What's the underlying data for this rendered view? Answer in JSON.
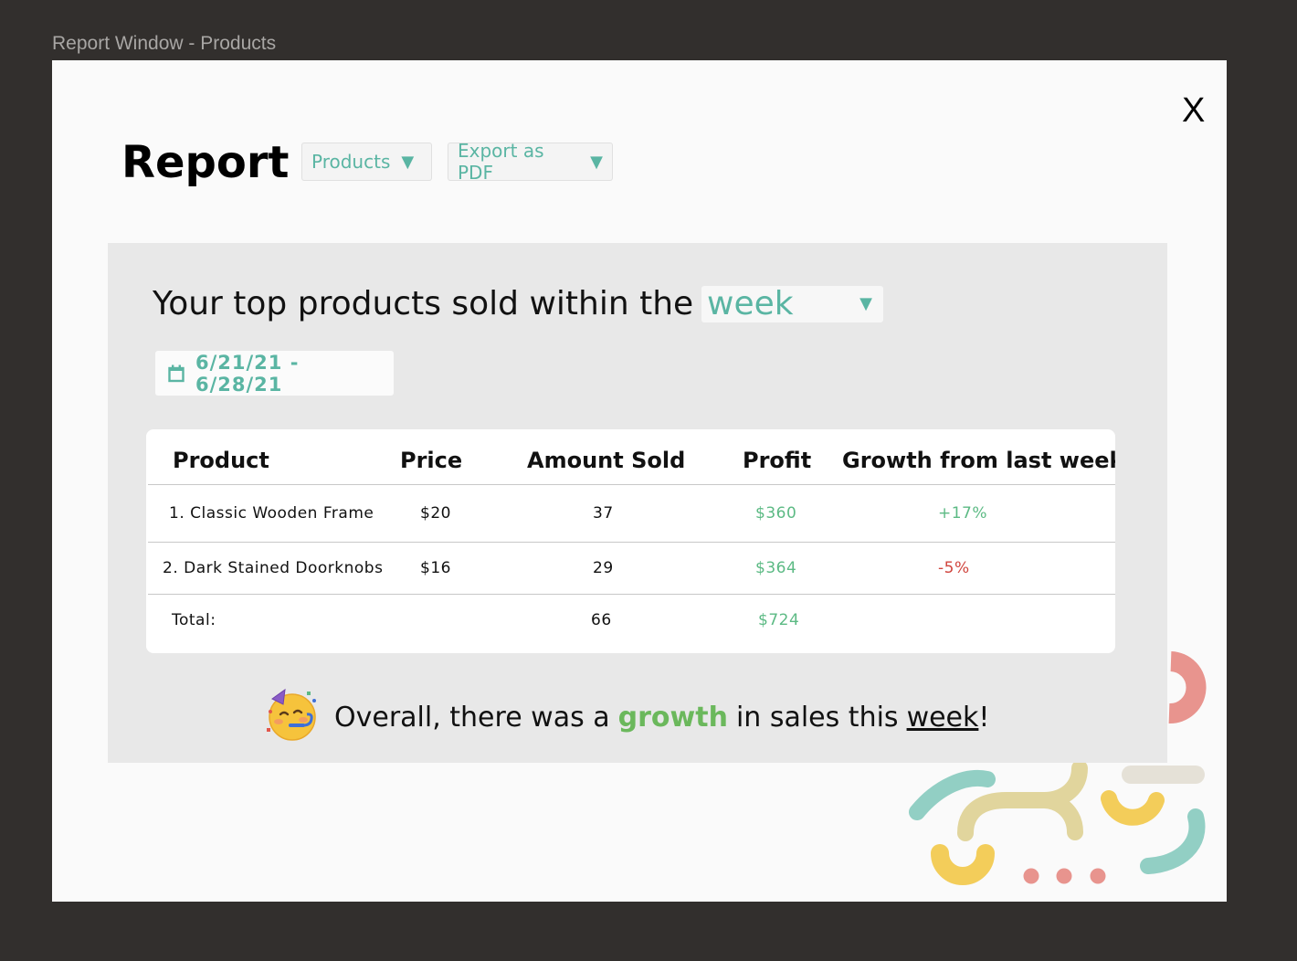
{
  "window": {
    "frame_title": "Report Window - Products",
    "close_label": "X"
  },
  "header": {
    "title": "Report",
    "report_type_dropdown": "Products",
    "export_dropdown": "Export as PDF"
  },
  "panel": {
    "headline": "Your top products sold within the",
    "period_value": "week",
    "date_range": "6/21/21 - 6/28/21"
  },
  "table": {
    "headers": [
      "Product",
      "Price",
      "Amount Sold",
      "Profit",
      "Growth from last week"
    ],
    "rows": [
      {
        "product": "1. Classic Wooden Frame",
        "price": "$20",
        "amount": "37",
        "profit": "$360",
        "growth": "+17%"
      },
      {
        "product": "2. Dark Stained Doorknobs",
        "price": "$16",
        "amount": "29",
        "profit": "$364",
        "growth": "-5%"
      }
    ],
    "total": {
      "label": "Total:",
      "amount": "66",
      "profit": "$724"
    }
  },
  "summary": {
    "prefix": "Overall, there was a",
    "highlight": "growth",
    "middle": "in sales this",
    "period": "week",
    "suffix": "!"
  },
  "colors": {
    "accent": "#5ab5a3",
    "positive": "#5cba84",
    "negative": "#d0453e",
    "growth_word": "#6bb85c"
  },
  "icons": {
    "calendar": "calendar-icon",
    "dropdown": "triangle-down-icon",
    "celebration": "partying-face-icon"
  }
}
